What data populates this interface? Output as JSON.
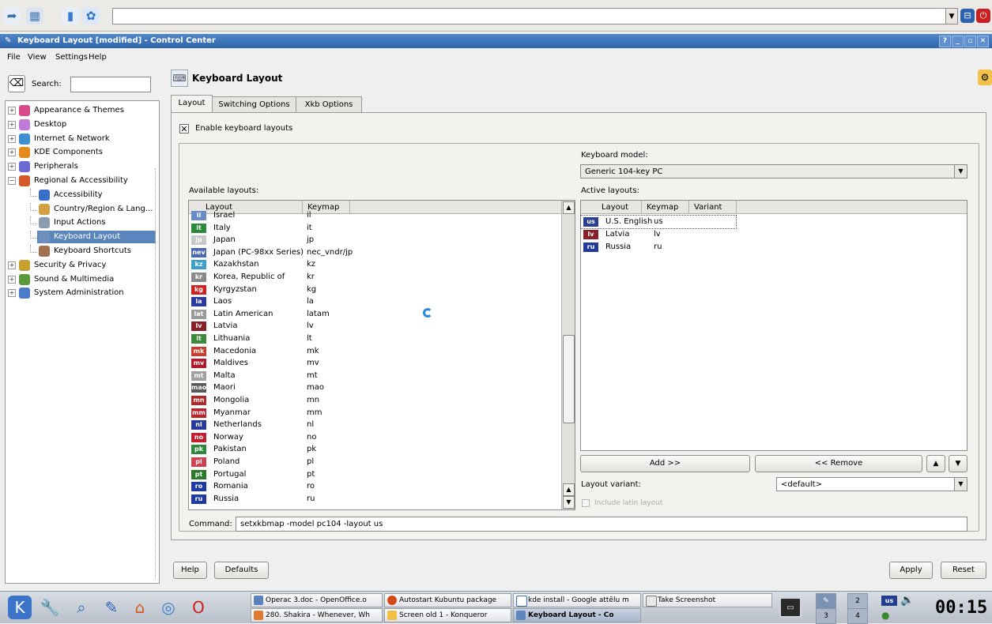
{
  "window": {
    "title": "Keyboard Layout [modified] - Control Center"
  },
  "menubar": {
    "items": [
      "File",
      "View",
      "Settings",
      "Help"
    ]
  },
  "search": {
    "label": "Search:",
    "value": ""
  },
  "sidebar": {
    "items": [
      {
        "label": "Appearance & Themes",
        "expander": "+"
      },
      {
        "label": "Desktop",
        "expander": "+"
      },
      {
        "label": "Internet & Network",
        "expander": "+"
      },
      {
        "label": "KDE Components",
        "expander": "+"
      },
      {
        "label": "Peripherals",
        "expander": "+"
      },
      {
        "label": "Regional & Accessibility",
        "expander": "−"
      },
      {
        "label": "Accessibility",
        "child": true
      },
      {
        "label": "Country/Region & Lang...",
        "child": true
      },
      {
        "label": "Input Actions",
        "child": true
      },
      {
        "label": "Keyboard Layout",
        "child": true,
        "selected": true
      },
      {
        "label": "Keyboard Shortcuts",
        "child": true
      },
      {
        "label": "Security & Privacy",
        "expander": "+"
      },
      {
        "label": "Sound & Multimedia",
        "expander": "+"
      },
      {
        "label": "System Administration",
        "expander": "+"
      }
    ]
  },
  "page": {
    "title": "Keyboard Layout"
  },
  "tabs": [
    "Layout",
    "Switching Options",
    "Xkb Options"
  ],
  "enable_checkbox": {
    "label": "Enable keyboard layouts",
    "checked": true
  },
  "available": {
    "label": "Available layouts:",
    "headers": [
      "Layout",
      "Keymap"
    ],
    "rows": [
      {
        "flag": "il",
        "name": "Israel",
        "map": "il"
      },
      {
        "flag": "it",
        "name": "Italy",
        "map": "it"
      },
      {
        "flag": "jp",
        "name": "Japan",
        "map": "jp"
      },
      {
        "flag": "nev",
        "name": "Japan (PC-98xx Series)",
        "map": "nec_vndr/jp"
      },
      {
        "flag": "kz",
        "name": "Kazakhstan",
        "map": "kz"
      },
      {
        "flag": "kr",
        "name": "Korea, Republic of",
        "map": "kr"
      },
      {
        "flag": "kg",
        "name": "Kyrgyzstan",
        "map": "kg"
      },
      {
        "flag": "la",
        "name": "Laos",
        "map": "la"
      },
      {
        "flag": "lat",
        "name": "Latin American",
        "map": "latam"
      },
      {
        "flag": "lv",
        "name": "Latvia",
        "map": "lv"
      },
      {
        "flag": "lt",
        "name": "Lithuania",
        "map": "lt"
      },
      {
        "flag": "mk",
        "name": "Macedonia",
        "map": "mk"
      },
      {
        "flag": "mv",
        "name": "Maldives",
        "map": "mv"
      },
      {
        "flag": "mt",
        "name": "Malta",
        "map": "mt"
      },
      {
        "flag": "mao",
        "name": "Maori",
        "map": "mao"
      },
      {
        "flag": "mn",
        "name": "Mongolia",
        "map": "mn"
      },
      {
        "flag": "mm",
        "name": "Myanmar",
        "map": "mm"
      },
      {
        "flag": "nl",
        "name": "Netherlands",
        "map": "nl"
      },
      {
        "flag": "no",
        "name": "Norway",
        "map": "no"
      },
      {
        "flag": "pk",
        "name": "Pakistan",
        "map": "pk"
      },
      {
        "flag": "pl",
        "name": "Poland",
        "map": "pl"
      },
      {
        "flag": "pt",
        "name": "Portugal",
        "map": "pt"
      },
      {
        "flag": "ro",
        "name": "Romania",
        "map": "ro"
      },
      {
        "flag": "ru",
        "name": "Russia",
        "map": "ru"
      }
    ]
  },
  "model": {
    "label": "Keyboard model:",
    "value": "Generic 104-key PC"
  },
  "active": {
    "label": "Active layouts:",
    "headers": [
      "Layout",
      "Keymap",
      "Variant"
    ],
    "rows": [
      {
        "flag": "us",
        "name": "U.S. English",
        "map": "us"
      },
      {
        "flag": "lv",
        "name": "Latvia",
        "map": "lv"
      },
      {
        "flag": "ru",
        "name": "Russia",
        "map": "ru"
      }
    ]
  },
  "buttons": {
    "add": "Add >>",
    "remove": "<< Remove",
    "help": "Help",
    "defaults": "Defaults",
    "apply": "Apply",
    "reset": "Reset"
  },
  "variant": {
    "label": "Layout variant:",
    "value": "<default>"
  },
  "latin": {
    "label": "Include latin layout",
    "checked": false
  },
  "command": {
    "label": "Command:",
    "value": "setxkbmap -model pc104 -layout us"
  },
  "taskbar": {
    "tasks": [
      "Operac 3.doc - OpenOffice.o",
      "Autostart Kubuntu package",
      "kde install - Google attēlu m",
      "Take Screenshot",
      "280. Shakira - Whenever, Wh",
      "Screen old 1 - Konqueror",
      "Keyboard Layout - Co"
    ],
    "desktops": [
      "2",
      "3",
      "4"
    ],
    "clock": "00:15",
    "kbd_indicator": "us"
  },
  "colors": {
    "titlebar": "#3c73b8",
    "selection": "#5b85bd",
    "window_bg": "#efefef"
  }
}
